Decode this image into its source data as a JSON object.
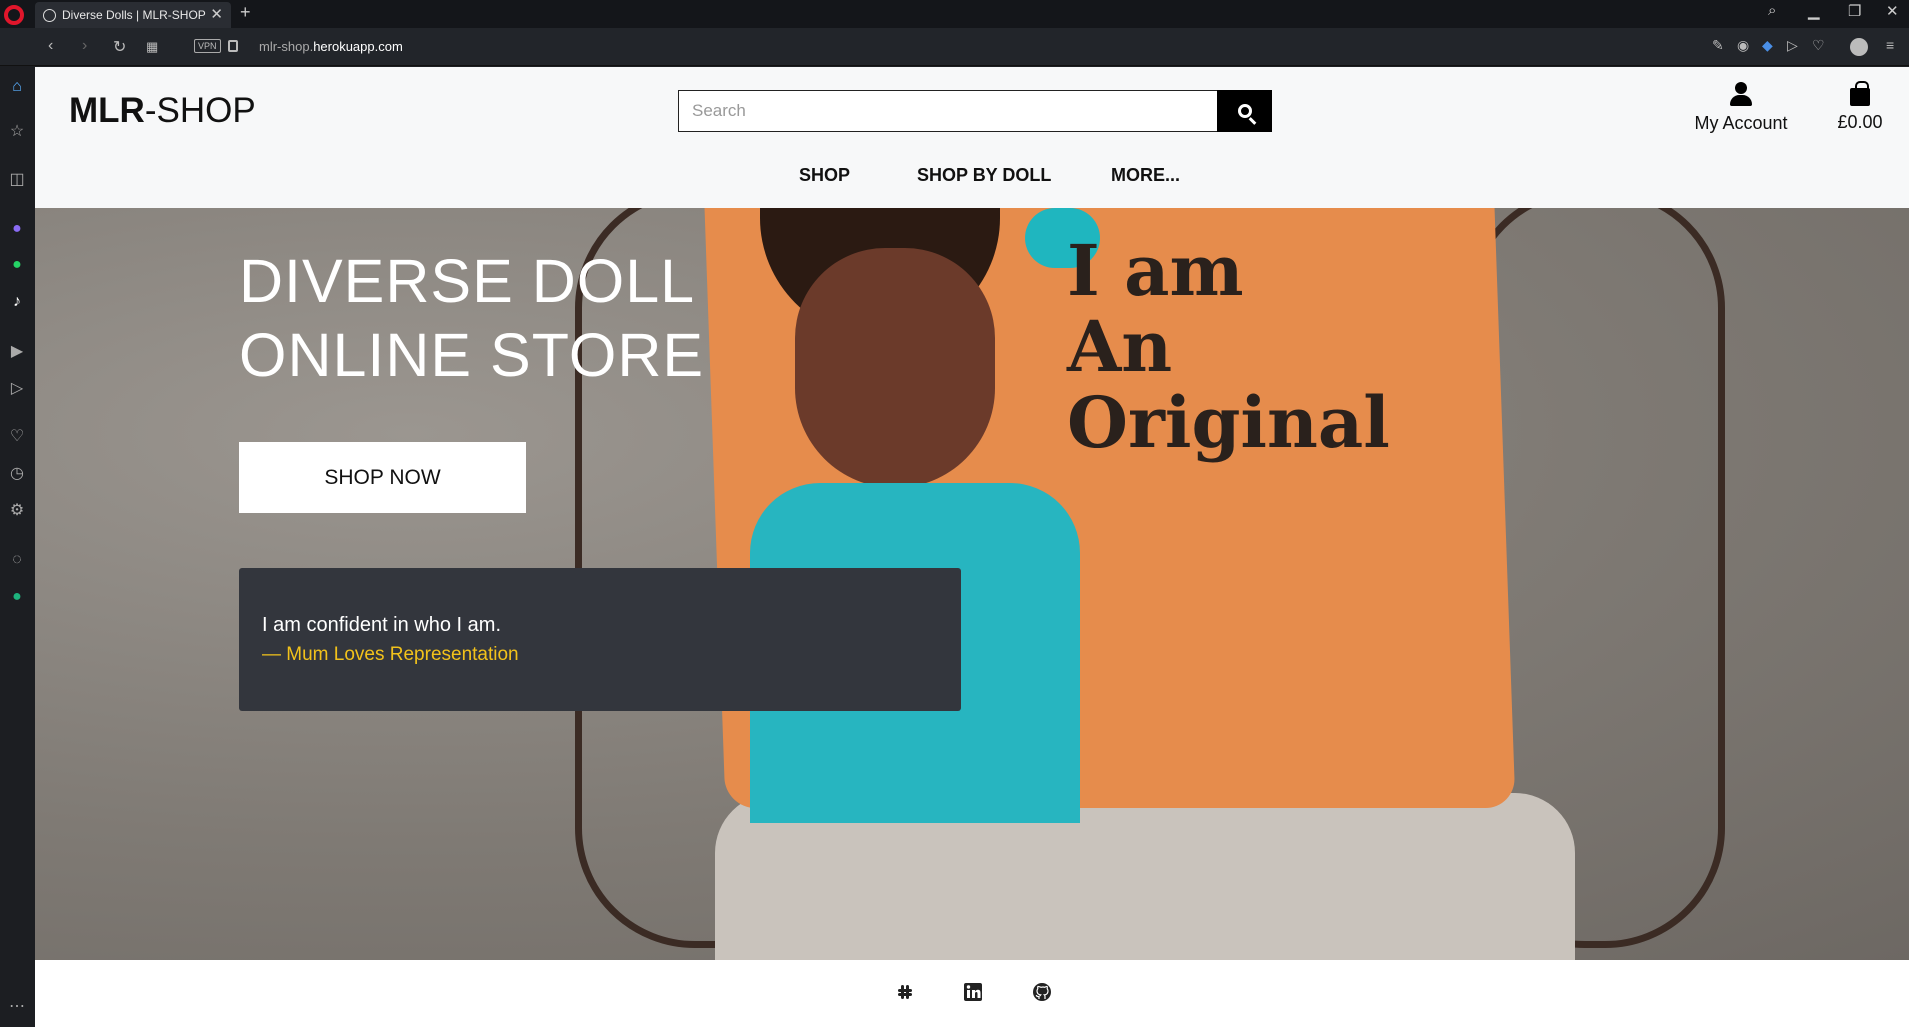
{
  "browser": {
    "tab_title": "Diverse Dolls | MLR-SHOP",
    "tab_close": "✕",
    "new_tab": "+",
    "url_prefix": "mlr-shop.",
    "url_domain": "herokuapp.com",
    "vpn_label": "VPN"
  },
  "header": {
    "logo_bold": "MLR",
    "logo_rest": "-SHOP",
    "search_placeholder": "Search",
    "account_label": "My Account",
    "cart_total": "£0.00",
    "nav": [
      "SHOP",
      "SHOP BY DOLL",
      "MORE..."
    ]
  },
  "hero": {
    "title": "DIVERSE DOLL ONLINE STORE",
    "cta_label": "SHOP NOW",
    "quote_text": "I am confident in who I am.",
    "quote_author": "— Mum Loves Representation",
    "pillow_text": [
      "I am",
      "An",
      "Original"
    ]
  },
  "footer": {
    "icons": [
      "slack-icon",
      "linkedin-icon",
      "github-icon"
    ]
  },
  "colors": {
    "quote_author": "#f2c21b",
    "quote_bg": "#33363d",
    "search_button": "#000000"
  }
}
